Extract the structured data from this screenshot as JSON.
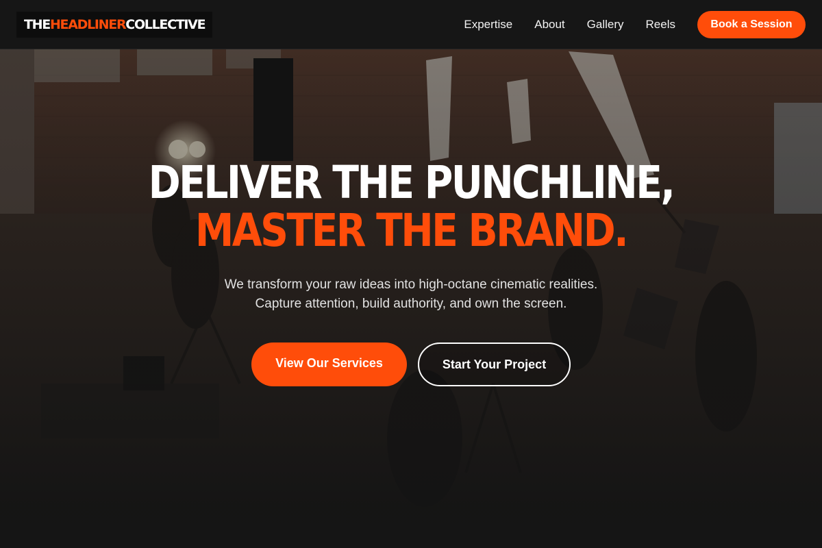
{
  "brand": {
    "logo_part1": "THE ",
    "logo_part2": "HEADLINER",
    "logo_part3": " COLLECTIVE",
    "accent_color": "#ff4d0a"
  },
  "nav": {
    "links": [
      {
        "label": "Expertise"
      },
      {
        "label": "About"
      },
      {
        "label": "Gallery"
      },
      {
        "label": "Reels"
      }
    ],
    "cta_label": "Book a Session"
  },
  "hero": {
    "headline_line1": "DELIVER THE PUNCHLINE,",
    "headline_line2": "MASTER THE BRAND.",
    "subtitle_line1": "We transform your raw ideas into high-octane cinematic realities.",
    "subtitle_line2": "Capture attention, build authority, and own the screen.",
    "primary_cta": "View Our Services",
    "secondary_cta": "Start Your Project",
    "background_image": "film-studio-warehouse-photo"
  }
}
